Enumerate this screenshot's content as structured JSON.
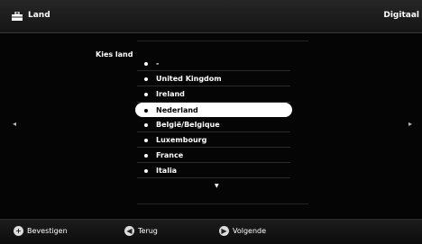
{
  "header": {
    "title": "Land",
    "mode": "Digitaal",
    "icon": "toolbox-icon"
  },
  "panel": {
    "label": "Kies land"
  },
  "countries": [
    {
      "label": "-",
      "selected": false
    },
    {
      "label": "United Kingdom",
      "selected": false
    },
    {
      "label": "Ireland",
      "selected": false
    },
    {
      "label": "Nederland",
      "selected": true
    },
    {
      "label": "België/Belgique",
      "selected": false
    },
    {
      "label": "Luxembourg",
      "selected": false
    },
    {
      "label": "France",
      "selected": false
    },
    {
      "label": "Italia",
      "selected": false
    }
  ],
  "nav": {
    "left_arrow": "◂",
    "right_arrow": "▸",
    "scroll_down": "▼"
  },
  "footer": {
    "confirm": {
      "label": "Bevestigen",
      "icon": "plus-circle-icon"
    },
    "back": {
      "label": "Terug",
      "icon": "arrow-left-circle-icon"
    },
    "next": {
      "label": "Volgende",
      "icon": "arrow-right-circle-icon"
    }
  }
}
